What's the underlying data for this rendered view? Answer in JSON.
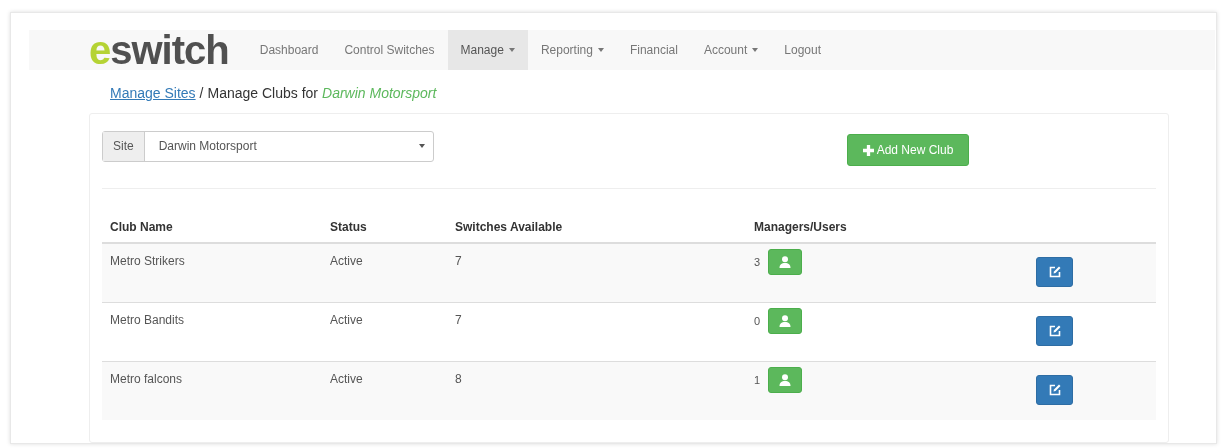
{
  "logo": {
    "prefix": "e",
    "rest": "switch"
  },
  "nav": [
    {
      "label": "Dashboard",
      "selected": false,
      "dropdown": false
    },
    {
      "label": "Control Switches",
      "selected": false,
      "dropdown": false
    },
    {
      "label": "Manage",
      "selected": true,
      "dropdown": true
    },
    {
      "label": "Reporting",
      "selected": false,
      "dropdown": true
    },
    {
      "label": "Financial",
      "selected": false,
      "dropdown": false
    },
    {
      "label": "Account",
      "selected": false,
      "dropdown": true
    },
    {
      "label": "Logout",
      "selected": false,
      "dropdown": false
    }
  ],
  "breadcrumb": {
    "link": "Manage Sites",
    "separator": "/",
    "text": "Manage Clubs for",
    "site": "Darwin Motorsport"
  },
  "site_select": {
    "label": "Site",
    "value": "Darwin Motorsport"
  },
  "add_button": {
    "label": "Add New Club"
  },
  "table": {
    "columns": [
      "Club Name",
      "Status",
      "Switches Available",
      "Managers/Users"
    ],
    "rows": [
      {
        "name": "Metro Strikers",
        "status": "Active",
        "switches": "7",
        "managers": "3"
      },
      {
        "name": "Metro Bandits",
        "status": "Active",
        "switches": "7",
        "managers": "0"
      },
      {
        "name": "Metro falcons",
        "status": "Active",
        "switches": "8",
        "managers": "1"
      }
    ]
  }
}
